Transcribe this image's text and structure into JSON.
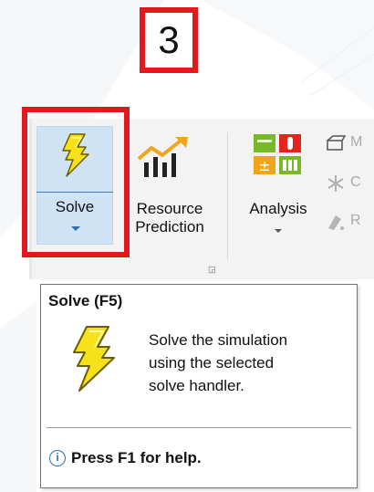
{
  "step_number": "3",
  "ribbon": {
    "solve_label": "Solve",
    "resource_prediction_label_line1": "Resource",
    "resource_prediction_label_line2": "Prediction",
    "analysis_label": "Analysis",
    "side_items": [
      "M",
      "C",
      "R"
    ]
  },
  "tooltip": {
    "title": "Solve (F5)",
    "body_line1": "Solve the simulation",
    "body_line2": "using the selected",
    "body_line3": "solve handler.",
    "help_text": "Press F1 for help."
  },
  "icons": {
    "solve": "lightning-bolt-icon",
    "resource_prediction": "growth-chart-icon",
    "analysis": "analysis-tools-icon",
    "help": "info-circle-icon"
  },
  "colors": {
    "highlight_red": "#e3171c",
    "solve_selected_bg": "#cfe3f5",
    "bolt_yellow": "#f6e11b"
  }
}
